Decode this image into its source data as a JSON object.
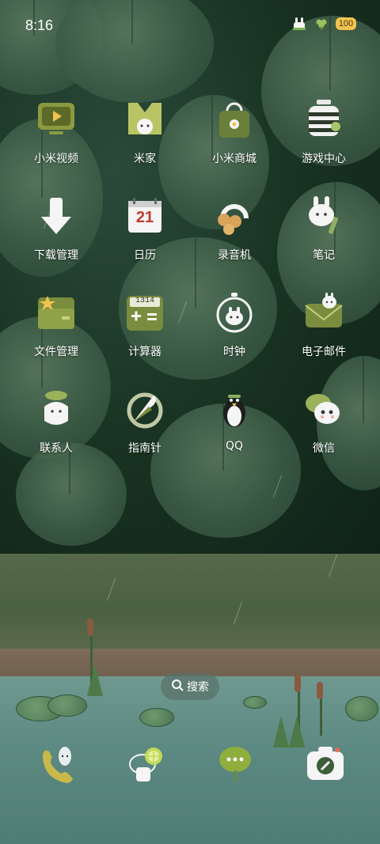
{
  "status_bar": {
    "time": "8:16",
    "battery": "100"
  },
  "apps": [
    {
      "label": "小米视频",
      "icon": "video-icon"
    },
    {
      "label": "米家",
      "icon": "mijia-icon"
    },
    {
      "label": "小米商城",
      "icon": "shopping-bag-icon"
    },
    {
      "label": "游戏中心",
      "icon": "game-center-icon"
    },
    {
      "label": "下载管理",
      "icon": "download-icon"
    },
    {
      "label": "日历",
      "icon": "calendar-icon",
      "badge": "21"
    },
    {
      "label": "录音机",
      "icon": "recorder-icon"
    },
    {
      "label": "笔记",
      "icon": "notes-icon"
    },
    {
      "label": "文件管理",
      "icon": "folder-icon"
    },
    {
      "label": "计算器",
      "icon": "calculator-icon",
      "badge": "1314"
    },
    {
      "label": "时钟",
      "icon": "clock-icon"
    },
    {
      "label": "电子邮件",
      "icon": "mail-icon"
    },
    {
      "label": "联系人",
      "icon": "contacts-icon"
    },
    {
      "label": "指南针",
      "icon": "compass-icon"
    },
    {
      "label": "QQ",
      "icon": "qq-penguin-icon"
    },
    {
      "label": "微信",
      "icon": "wechat-icon"
    }
  ],
  "search": {
    "label": "搜索"
  },
  "dock": [
    {
      "icon": "phone-icon"
    },
    {
      "icon": "browser-lemon-icon"
    },
    {
      "icon": "messages-icon"
    },
    {
      "icon": "camera-icon"
    }
  ],
  "colors": {
    "label": "#ffffff",
    "wallpaper_top": "#17301f",
    "water": "#5d8a82",
    "battery": "#f2c24f"
  }
}
